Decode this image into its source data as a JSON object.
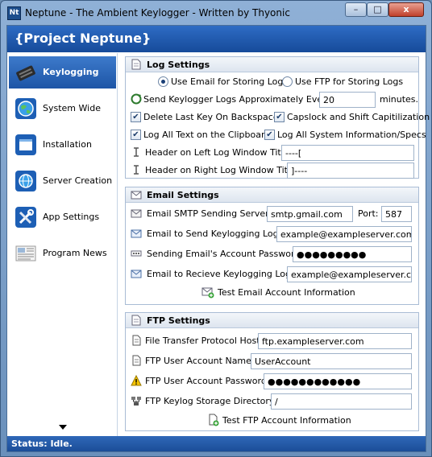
{
  "window": {
    "icon_text": "Nt",
    "title": "Neptune - The Ambient Keylogger - Written by Thyonic",
    "minimize": "–",
    "maximize": "□",
    "close": "x"
  },
  "header": {
    "title": "{Project Neptune}"
  },
  "sidebar": {
    "items": [
      {
        "label": "Keylogging",
        "icon": "keyboard-icon",
        "active": true
      },
      {
        "label": "System Wide",
        "icon": "globe-icon"
      },
      {
        "label": "Installation",
        "icon": "window-icon"
      },
      {
        "label": "Server Creation",
        "icon": "server-globe-icon"
      },
      {
        "label": "App Settings",
        "icon": "tools-icon"
      },
      {
        "label": "Program News",
        "icon": "newspaper-icon"
      }
    ]
  },
  "log_settings": {
    "title": "Log Settings",
    "use_email_label": "Use Email for Storing Logs",
    "use_ftp_label": "Use FTP for Storing Logs",
    "use_email_selected": true,
    "send_every_label": "Send Keylogger Logs Approximately Every:",
    "send_every_value": "20",
    "send_every_unit": "minutes.",
    "delete_backspace_label": "Delete Last Key On Backspace",
    "delete_backspace_checked": true,
    "capslock_label": "Capslock and Shift Capitilization",
    "capslock_checked": true,
    "clipboard_label": "Log All Text on the Clipboard",
    "clipboard_checked": true,
    "sysinfo_label": "Log All System Information/Specs",
    "sysinfo_checked": true,
    "header_left_label": "Header on Left Log Window Title:",
    "header_left_value": "----[",
    "header_right_label": "Header on Right Log Window Title:",
    "header_right_value": "]----"
  },
  "email_settings": {
    "title": "Email Settings",
    "smtp_label": "Email SMTP Sending Server:",
    "smtp_value": "smtp.gmail.com",
    "port_label": "Port:",
    "port_value": "587",
    "send_to_label": "Email to Send Keylogging Logs:",
    "send_to_value": "example@exampleserver.com",
    "password_label": "Sending Email's Account Password:",
    "password_value": "●●●●●●●●●",
    "receive_label": "Email to Recieve Keylogging Logs:",
    "receive_value": "example@exampleserver.com",
    "test_button": "Test Email Account Information"
  },
  "ftp_settings": {
    "title": "FTP Settings",
    "host_label": "File Transfer Protocol Host:",
    "host_value": "ftp.exampleserver.com",
    "user_label": "FTP User Account Name:",
    "user_value": "UserAccount",
    "password_label": "FTP User Account Password:",
    "password_value": "●●●●●●●●●●●●",
    "dir_label": "FTP Keylog Storage Directory:",
    "dir_value": "/",
    "test_button": "Test FTP Account Information"
  },
  "status": {
    "text": "Status: Idle."
  }
}
